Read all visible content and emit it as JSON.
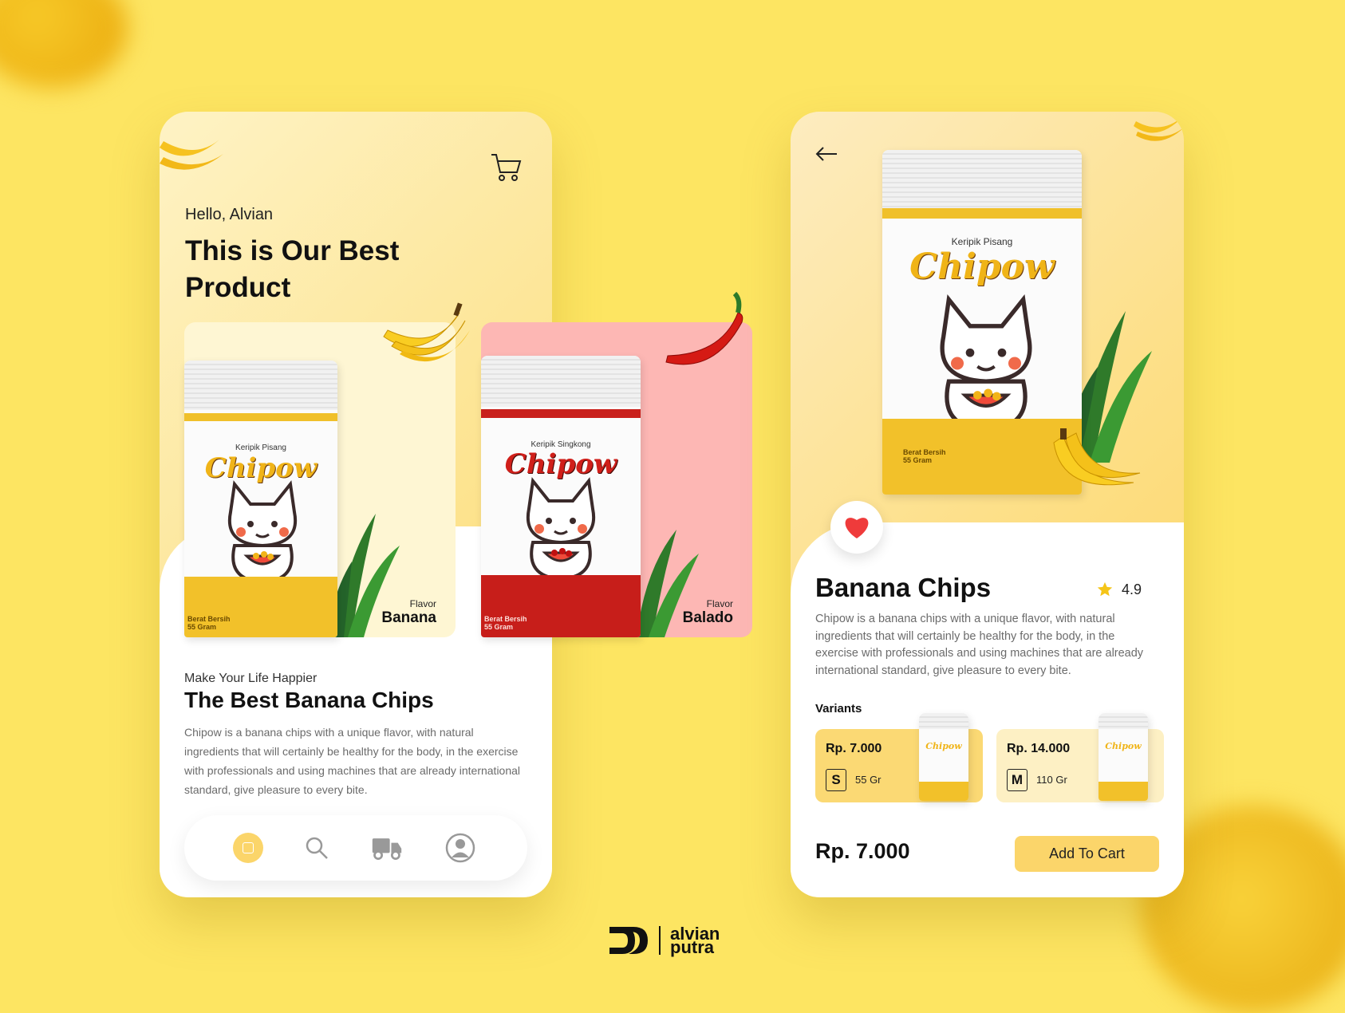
{
  "colors": {
    "background": "#fde562",
    "accent": "#fbd56a",
    "heart": "#ef3b3b",
    "balado_card": "#fdb7b4",
    "banana_card": "#fef6d3"
  },
  "home": {
    "greeting": "Hello, Alvian",
    "headline": "This is Our Best Product",
    "products": [
      {
        "brand": "Chipow",
        "type": "Keripik Pisang",
        "flavor_label": "Flavor",
        "flavor": "Banana",
        "weight_label": "Berat Bersih",
        "weight": "55 Gram"
      },
      {
        "brand": "Chipow",
        "type": "Keripik Singkong",
        "flavor_label": "Flavor",
        "flavor": "Balado",
        "weight_label": "Berat Bersih",
        "weight": "55 Gram"
      }
    ],
    "tagline": "Make Your Life Happier",
    "section_title": "The Best Banana Chips",
    "description": "Chipow is a banana chips with a unique flavor, with natural ingredients that will certainly be healthy for the body, in the exercise with professionals and using machines that are already international standard, give pleasure to every bite.",
    "nav": [
      {
        "icon": "home-icon"
      },
      {
        "icon": "search-icon"
      },
      {
        "icon": "delivery-truck-icon"
      },
      {
        "icon": "profile-icon"
      }
    ]
  },
  "detail": {
    "pouch": {
      "brand": "Chipow",
      "type": "Keripik Pisang",
      "weight_label": "Berat Bersih",
      "weight": "55 Gram"
    },
    "title": "Banana Chips",
    "rating": "4.9",
    "description": "Chipow is a banana chips with a unique flavor, with natural ingredients that will certainly be healthy for the body, in the exercise with professionals and using machines that are already international standard, give pleasure to every bite.",
    "variants_label": "Variants",
    "variants": [
      {
        "price": "Rp. 7.000",
        "size": "S",
        "gram": "55 Gr",
        "brand": "Chipow"
      },
      {
        "price": "Rp. 14.000",
        "size": "M",
        "gram": "110 Gr",
        "brand": "Chipow"
      }
    ],
    "total_price": "Rp. 7.000",
    "add_to_cart": "Add To Cart"
  },
  "logo": {
    "line1": "alvian",
    "line2": "putra"
  }
}
